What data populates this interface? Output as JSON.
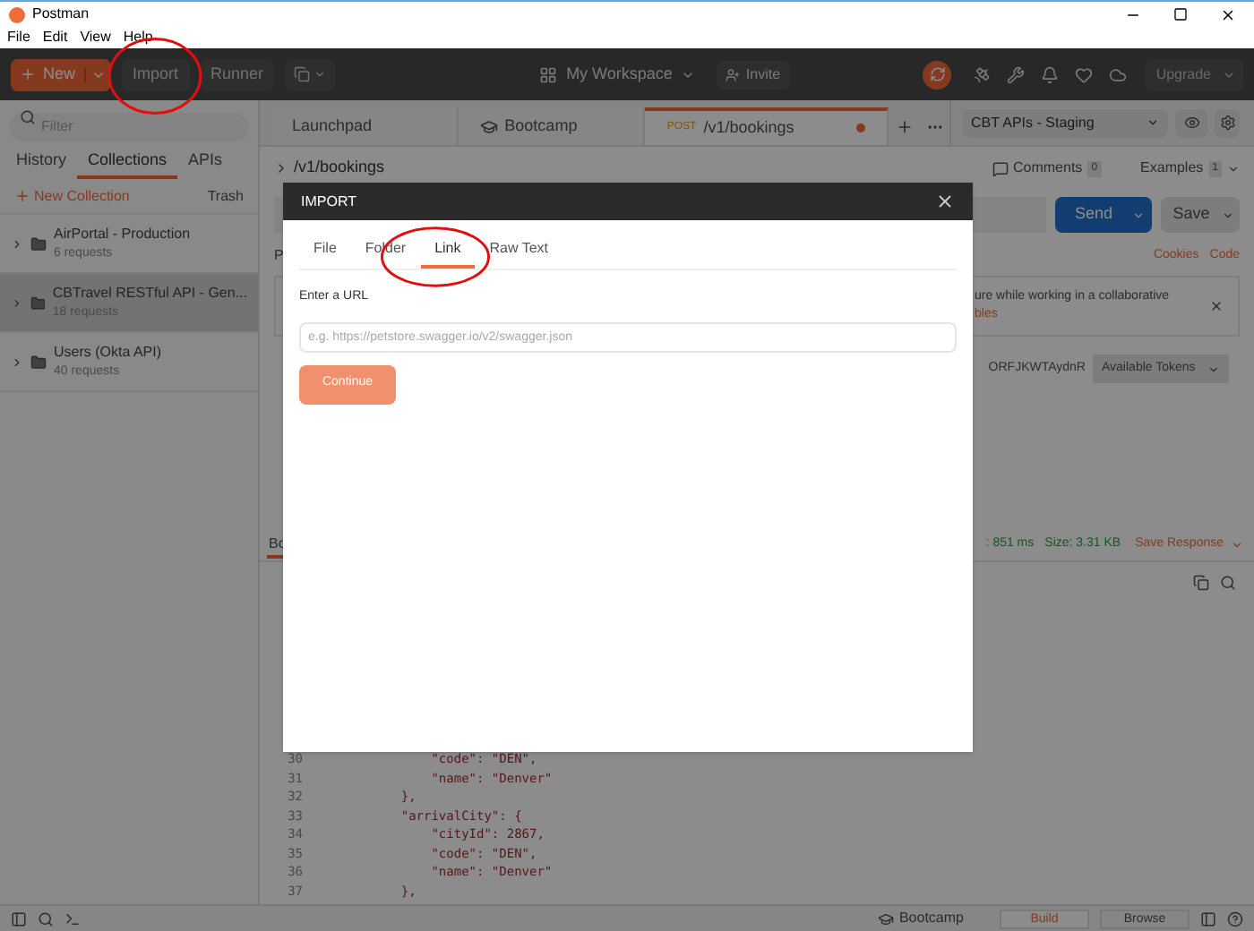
{
  "window": {
    "title": "Postman"
  },
  "menu": [
    "File",
    "Edit",
    "View",
    "Help"
  ],
  "toolbar": {
    "new": "New",
    "import": "Import",
    "runner": "Runner",
    "workspace": "My Workspace",
    "invite": "Invite",
    "upgrade": "Upgrade"
  },
  "sidebar": {
    "filter_placeholder": "Filter",
    "tabs": [
      {
        "label": "History",
        "selected": false
      },
      {
        "label": "Collections",
        "selected": true
      },
      {
        "label": "APIs",
        "selected": false
      }
    ],
    "new_collection": "New Collection",
    "trash": "Trash",
    "collections": [
      {
        "name": "AirPortal - Production",
        "count": "6 requests",
        "selected": false
      },
      {
        "name": "CBTravel RESTful API - Gen...",
        "count": "18 requests",
        "selected": true
      },
      {
        "name": "Users (Okta API)",
        "count": "40 requests",
        "selected": false
      }
    ]
  },
  "request_tabs": [
    {
      "kind": "plain",
      "label": "Launchpad",
      "selected": false
    },
    {
      "kind": "bootcamp",
      "label": "Bootcamp",
      "selected": false
    },
    {
      "kind": "request",
      "method": "POST",
      "label": "/v1/bookings",
      "selected": true
    }
  ],
  "environment": "CBT APIs - Staging",
  "request": {
    "title": "/v1/bookings",
    "comments": "Comments",
    "comments_count": "0",
    "examples": "Examples",
    "examples_count": "1",
    "send": "Send",
    "save": "Save",
    "cookies": "Cookies",
    "code": "Code",
    "notice_line_1": "ure while working in a collaborative",
    "notice_line_2": "bles",
    "token": "ORFJKWTAydnR",
    "token_select": "Available Tokens",
    "params_fragment": "P"
  },
  "response": {
    "tab_fragment": "Bo",
    "status_fragment": ":",
    "time": "851 ms",
    "size": "Size: 3.31 KB",
    "save_response": "Save Response",
    "code_lines": [
      {
        "number": "30",
        "text": "        \"code\": \"DEN\","
      },
      {
        "number": "31",
        "text": "        \"name\": \"Denver\""
      },
      {
        "number": "32",
        "text": "    },"
      },
      {
        "number": "33",
        "text": "    \"arrivalCity\": {"
      },
      {
        "number": "34",
        "text": "        \"cityId\": 2867,"
      },
      {
        "number": "35",
        "text": "        \"code\": \"DEN\","
      },
      {
        "number": "36",
        "text": "        \"name\": \"Denver\""
      },
      {
        "number": "37",
        "text": "    },"
      }
    ]
  },
  "status_bar": {
    "bootcamp": "Bootcamp",
    "build": "Build",
    "browse": "Browse"
  },
  "import_dialog": {
    "title": "IMPORT",
    "tabs": [
      {
        "label": "File",
        "selected": false
      },
      {
        "label": "Folder",
        "selected": false
      },
      {
        "label": "Link",
        "selected": true
      },
      {
        "label": "Raw Text",
        "selected": false
      }
    ],
    "url_label": "Enter a URL",
    "url_placeholder": "e.g. https://petstore.swagger.io/v2/swagger.json",
    "continue": "Continue",
    "continue_disabled": true
  }
}
